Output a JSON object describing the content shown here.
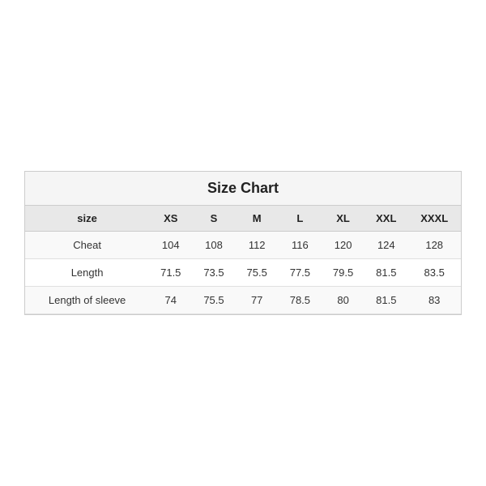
{
  "chart": {
    "title": "Size Chart",
    "columns": [
      "size",
      "XS",
      "S",
      "M",
      "L",
      "XL",
      "XXL",
      "XXXL"
    ],
    "rows": [
      {
        "label": "Cheat",
        "values": [
          "104",
          "108",
          "112",
          "116",
          "120",
          "124",
          "128"
        ]
      },
      {
        "label": "Length",
        "values": [
          "71.5",
          "73.5",
          "75.5",
          "77.5",
          "79.5",
          "81.5",
          "83.5"
        ]
      },
      {
        "label": "Length of sleeve",
        "values": [
          "74",
          "75.5",
          "77",
          "78.5",
          "80",
          "81.5",
          "83"
        ]
      }
    ]
  }
}
